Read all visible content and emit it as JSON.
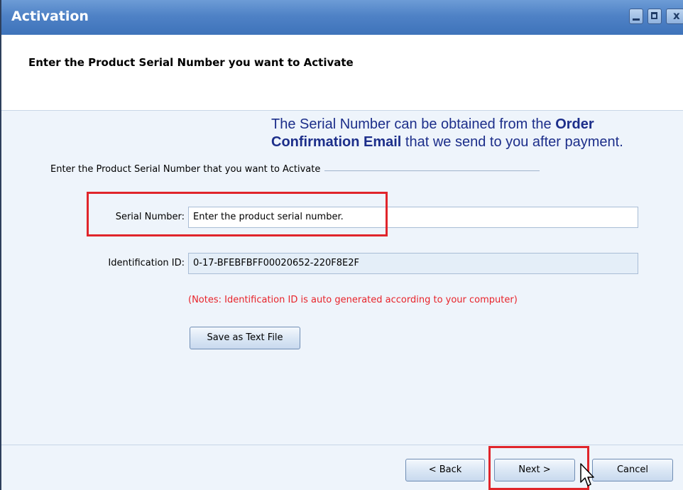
{
  "window": {
    "title": "Activation"
  },
  "header": {
    "title": "Enter the Product Serial Number you want to Activate"
  },
  "info": {
    "line_start": "The Serial Number can be obtained from the ",
    "bold_1": "Order Confirmation Email",
    "line_end": " that we send to you after payment."
  },
  "group": {
    "label": "Enter the Product Serial Number that you want to Activate"
  },
  "fields": {
    "serial_label": "Serial Number:",
    "serial_placeholder": "Enter the product serial number.",
    "ident_label": "Identification ID:",
    "ident_value": "0-17-BFEBFBFF00020652-220F8E2F"
  },
  "notes": "(Notes: Identification ID is auto generated according to your computer)",
  "buttons": {
    "save": "Save as Text File",
    "back": "< Back",
    "next": "Next >",
    "cancel": "Cancel"
  },
  "colors": {
    "titlebar": "#4f82c6",
    "info_text": "#1c2e8a",
    "notes": "#e8232a",
    "highlight": "#e0252b"
  },
  "icons": [
    "minimize-icon",
    "maximize-icon",
    "close-icon",
    "mouse-pointer-icon"
  ]
}
